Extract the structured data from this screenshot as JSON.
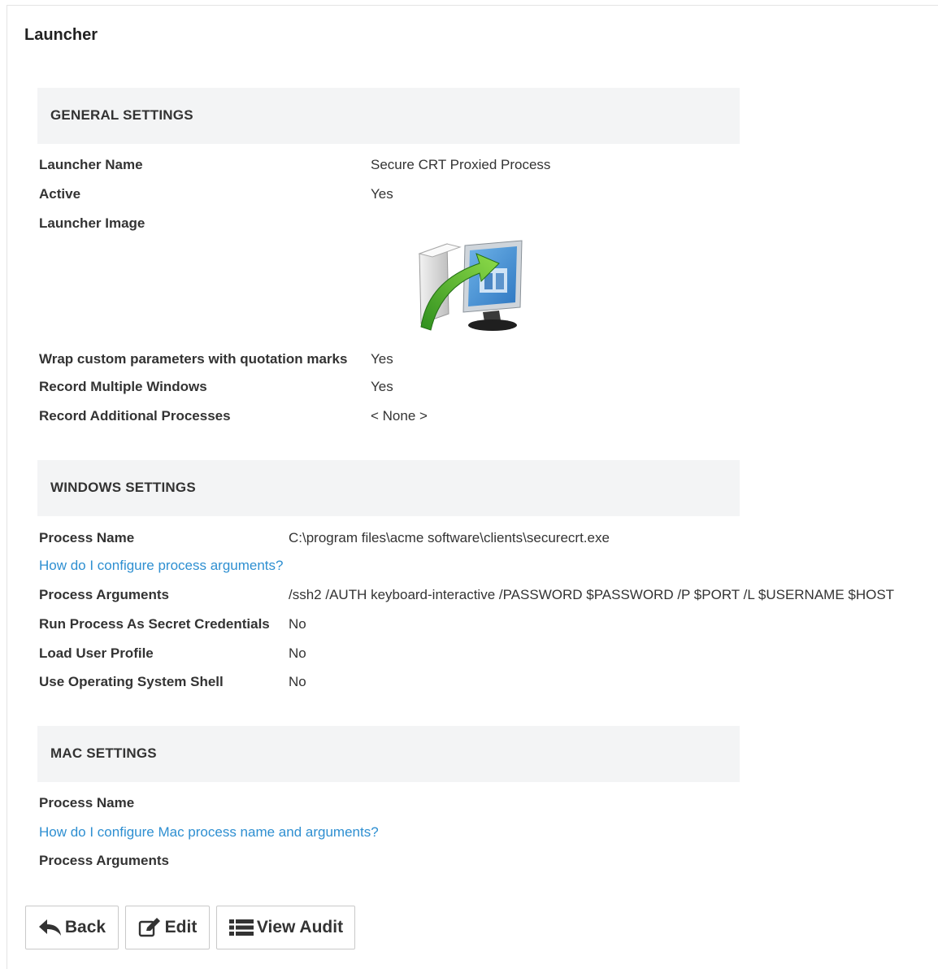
{
  "page": {
    "title": "Launcher"
  },
  "general": {
    "heading": "GENERAL SETTINGS",
    "launcher_name_label": "Launcher Name",
    "launcher_name_value": "Secure CRT Proxied Process",
    "active_label": "Active",
    "active_value": "Yes",
    "launcher_image_label": "Launcher Image",
    "launcher_image_icon": "launcher-monitor-arrow-icon",
    "wrap_label": "Wrap custom parameters with quotation marks",
    "wrap_value": "Yes",
    "record_windows_label": "Record Multiple Windows",
    "record_windows_value": "Yes",
    "record_processes_label": "Record Additional Processes",
    "record_processes_value": "< None >"
  },
  "windows": {
    "heading": "WINDOWS SETTINGS",
    "process_name_label": "Process Name",
    "process_name_value": "C:\\program files\\acme software\\clients\\securecrt.exe",
    "help_link": "How do I configure process arguments?",
    "process_args_label": "Process Arguments",
    "process_args_value": "/ssh2 /AUTH keyboard-interactive /PASSWORD $PASSWORD /P $PORT /L $USERNAME $HOST",
    "run_as_label": "Run Process As Secret Credentials",
    "run_as_value": "No",
    "load_profile_label": "Load User Profile",
    "load_profile_value": "No",
    "os_shell_label": "Use Operating System Shell",
    "os_shell_value": "No"
  },
  "mac": {
    "heading": "MAC SETTINGS",
    "process_name_label": "Process Name",
    "help_link": "How do I configure Mac process name and arguments?",
    "process_args_label": "Process Arguments"
  },
  "buttons": {
    "back": "Back",
    "edit": "Edit",
    "audit": "View Audit"
  },
  "colors": {
    "link": "#2e8fd1",
    "section_bg": "#f3f4f5"
  }
}
